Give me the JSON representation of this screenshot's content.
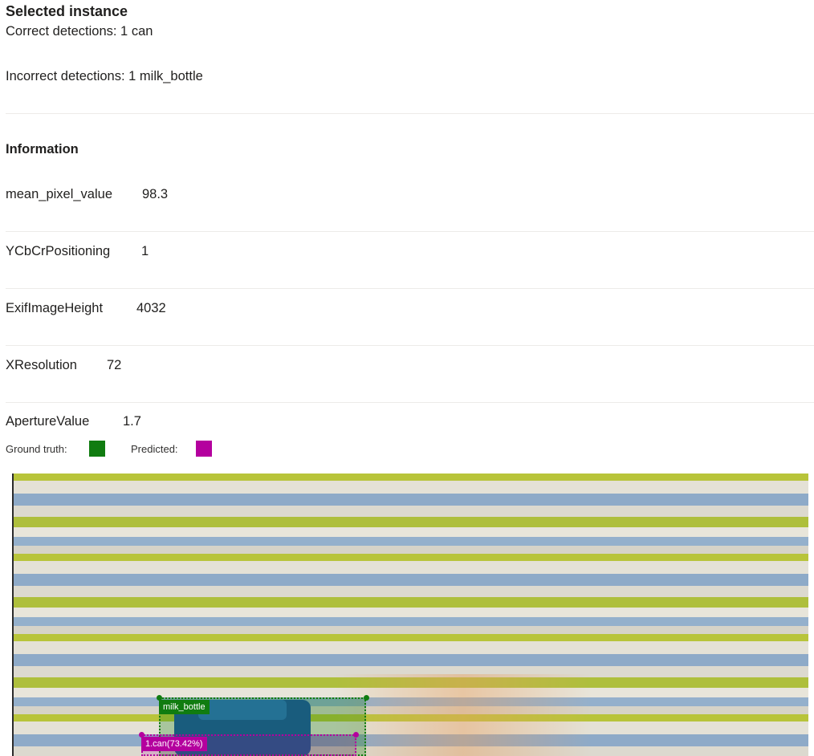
{
  "selected": {
    "title": "Selected instance",
    "correct": "Correct detections: 1 can",
    "incorrect": "Incorrect detections: 1 milk_bottle"
  },
  "information": {
    "title": "Information",
    "rows": [
      {
        "key": "mean_pixel_value",
        "value": "98.3"
      },
      {
        "key": "YCbCrPositioning",
        "value": "1"
      },
      {
        "key": "ExifImageHeight",
        "value": "4032"
      },
      {
        "key": "XResolution",
        "value": "72"
      },
      {
        "key": "ApertureValue",
        "value": "1.7"
      }
    ]
  },
  "legend": {
    "ground_truth_label": "Ground truth:",
    "predicted_label": "Predicted:",
    "ground_truth_color": "#107c10",
    "predicted_color": "#b4009e"
  },
  "annotations": {
    "ground_truth_box_label": "milk_bottle",
    "predicted_box_label": "1.can(73.42%)"
  }
}
